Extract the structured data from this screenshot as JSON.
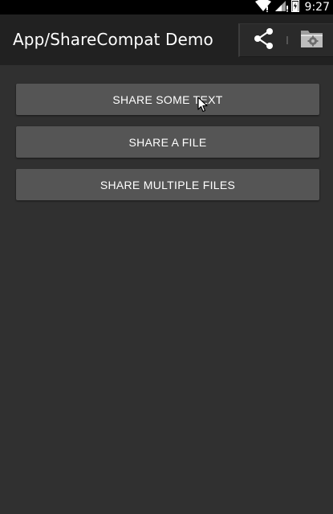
{
  "status_bar": {
    "time": "9:27",
    "icons": [
      "wifi-icon",
      "signal-icon",
      "battery-icon"
    ]
  },
  "action_bar": {
    "title": "App/ShareCompat Demo",
    "actions": [
      "share-icon",
      "file-manager-icon"
    ]
  },
  "buttons": {
    "share_text": "SHARE SOME TEXT",
    "share_file": "SHARE A FILE",
    "share_multiple": "SHARE MULTIPLE FILES"
  },
  "colors": {
    "background": "#303030",
    "action_bar": "#212121",
    "button": "#555555",
    "text": "#ffffff"
  }
}
